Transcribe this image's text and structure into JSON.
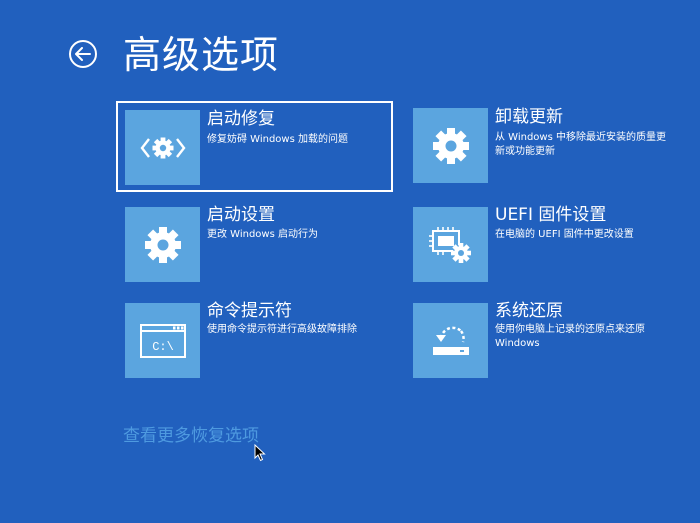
{
  "header": {
    "title": "高级选项",
    "back_icon": "back-arrow-icon"
  },
  "options": [
    {
      "id": "startup-repair",
      "label": "启动修复",
      "description": "修复妨碍 Windows 加载的问题",
      "icon": "code-gear-icon",
      "selected": true
    },
    {
      "id": "uninstall-updates",
      "label": "卸载更新",
      "description": "从 Windows 中移除最近安装的质量更新或功能更新",
      "icon": "gear-icon",
      "selected": false
    },
    {
      "id": "startup-settings",
      "label": "启动设置",
      "description": "更改 Windows 启动行为",
      "icon": "gear-icon",
      "selected": false
    },
    {
      "id": "uefi-settings",
      "label": "UEFI 固件设置",
      "description": "在电脑的 UEFI 固件中更改设置",
      "icon": "chip-gear-icon",
      "selected": false
    },
    {
      "id": "command-prompt",
      "label": "命令提示符",
      "description": "使用命令提示符进行高级故障排除",
      "icon": "command-prompt-icon",
      "selected": false
    },
    {
      "id": "system-restore",
      "label": "系统还原",
      "description": "使用你电脑上记录的还原点来还原 Windows",
      "icon": "restore-icon",
      "selected": false
    }
  ],
  "more_link": "查看更多恢复选项",
  "cmd_icon_text": "C:\\",
  "colors": {
    "background": "#2160be",
    "tile": "#5ba5df",
    "link": "#4e9ae0",
    "text": "#ffffff"
  }
}
